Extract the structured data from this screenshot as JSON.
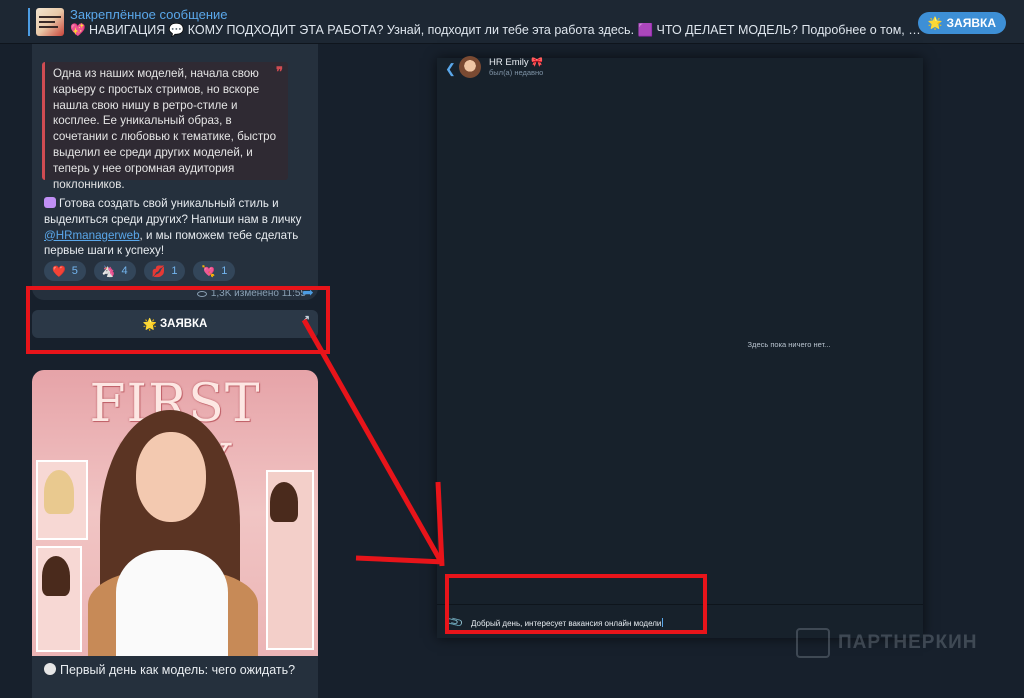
{
  "pinned": {
    "title": "Закреплённое сообщение",
    "text": "💖 НАВИГАЦИЯ 💬 КОМУ ПОДХОДИТ ЭТА РАБОТА? Узнай, подходит ли тебе эта работа здесь. 🟪 ЧТО ДЕЛАЕТ МОДЕЛЬ? Подробнее о том, что вк...",
    "button_label": "ЗАЯВКА",
    "button_emoji": "🌟"
  },
  "message": {
    "quote": "Одна из наших моделей, начала свою карьеру с простых стримов, но вскоре нашла свою нишу в ретро-стиле и косплее. Ее уникальный образ, в сочетании с любовью к тематике, быстро выделил ее среди других моделей, и теперь у нее огромная аудитория поклонников.",
    "body_before": "Готова создать свой уникальный стиль и выделиться среди других? Напиши нам в личку ",
    "link": "@HRmanagerweb",
    "body_after": ", и мы поможем тебе сделать первые шаги к успеху!",
    "reactions": [
      {
        "emoji": "❤️",
        "count": "5"
      },
      {
        "emoji": "🦄",
        "count": "4"
      },
      {
        "emoji": "💋",
        "count": "1"
      },
      {
        "emoji": "💘",
        "count": "1"
      }
    ],
    "meta": "1,3K изменено 11:55",
    "keyboard_button": "ЗАЯВКА",
    "keyboard_emoji": "🌟"
  },
  "image_message": {
    "art_title": "FIRST DAY",
    "caption": "Первый день как модель: чего ожидать?"
  },
  "chat": {
    "name": "HR Emily 🎀",
    "status": "был(а) недавно",
    "empty_text": "Здесь пока ничего нет...",
    "input_text": "Добрый день, интересует вакансия онлайн модели"
  },
  "watermark": "ПАРТНЕРКИН",
  "colors": {
    "annotation_red": "#e8141a",
    "accent_blue": "#4c9ce2",
    "background": "#17202c"
  }
}
